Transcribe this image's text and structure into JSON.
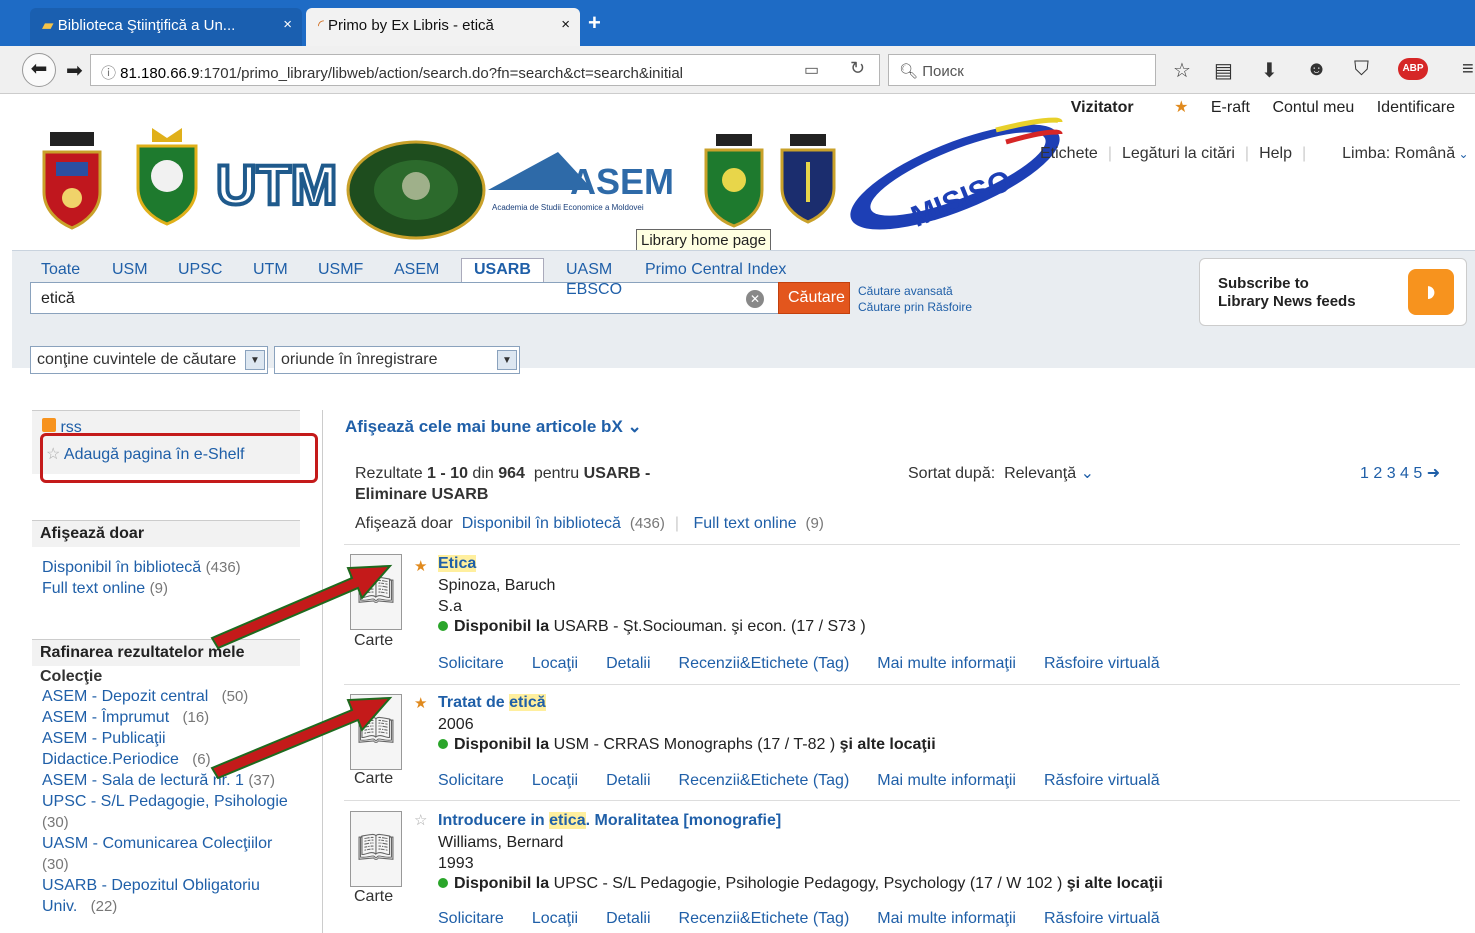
{
  "browser": {
    "tabs": [
      {
        "label": "Biblioteca Ştiinţifică a Un...",
        "close": "×"
      },
      {
        "label": "Primo by Ex Libris - etică",
        "close": "×"
      }
    ],
    "new_tab": "+",
    "url_host": "81.180.66.9",
    "url_rest": ":1701/primo_library/libweb/action/search.do?fn=search&ct=search&initial",
    "search_placeholder": "Поиск"
  },
  "header": {
    "user_links": [
      "Vizitator",
      "E-raft",
      "Contul meu",
      "Identificare"
    ],
    "secondary": {
      "tags": "Etichete",
      "citations": "Legături la citări",
      "help": "Help",
      "lang_label": "Limba:",
      "lang_value": "Română"
    },
    "logo_utm": "UTM",
    "logo_asem": "ASEM",
    "logo_asem_sub": "Academia de Studii Economice a Moldovei",
    "logo_misiso": "MISISO",
    "tooltip": "Library home page"
  },
  "scopes": [
    "Toate",
    "USM",
    "UPSC",
    "UTM",
    "USMF",
    "ASEM",
    "USARB",
    "UASM",
    "Primo Central Index"
  ],
  "scope_extra": "EBSCO",
  "search": {
    "value": "etică",
    "button": "Căutare",
    "advanced": "Căutare avansată",
    "browse": "Căutare prin Răsfoire"
  },
  "rss_feed": {
    "line1": "Subscribe to",
    "line2": "Library News feeds"
  },
  "filters": {
    "mode": "conţine cuvintele de căutare",
    "field": "oriunde în înregistrare"
  },
  "left": {
    "rss": "rss",
    "eshelf": "Adaugă pagina în e-Shelf",
    "show_only_title": "Afişează doar",
    "show_only": [
      {
        "label": "Disponibil în bibliotecă",
        "count": "(436)"
      },
      {
        "label": "Full text online",
        "count": "(9)"
      }
    ],
    "refine_title": "Rafinarea rezultatelor mele",
    "collection": "Colecţie",
    "facets": [
      {
        "label": "ASEM - Depozit central",
        "count": "(50)"
      },
      {
        "label": "ASEM - Împrumut",
        "count": "(16)"
      },
      {
        "label": "ASEM - Publicaţii Didactice.Periodice",
        "count": "(6)"
      },
      {
        "label": "ASEM - Sala de lectură nr. 1",
        "count": "(37)"
      },
      {
        "label": "UPSC - S/L Pedagogie, Psihologie",
        "count": "(30)"
      },
      {
        "label": "UASM - Comunicarea Colecţiilor",
        "count": "(30)"
      },
      {
        "label": "USARB - Depozitul Obligatoriu Univ.",
        "count": "(22)"
      }
    ]
  },
  "results_header": {
    "bx": "Afişează cele mai bune articole bX",
    "summary_prefix": "Rezultate",
    "range": "1 - 10",
    "of": "din",
    "total": "964",
    "for": "pentru",
    "scope": "USARB -",
    "remove": "Eliminare USARB",
    "sort_label": "Sortat după:",
    "sort_value": "Relevanţă",
    "pages": "1 2 3 4 5",
    "show_only": "Afişează doar",
    "avail": "Disponibil în bibliotecă",
    "avail_count": "(436)",
    "fulltext": "Full text online",
    "fulltext_count": "(9)"
  },
  "results": [
    {
      "title_pre": "",
      "title_hl": "Etica",
      "title_post": "",
      "author": "Spinoza, Baruch",
      "extra": "S.a",
      "avail_bold": "Disponibil la",
      "avail_text": "USARB - Şt.Sociouman. şi econ.  (17 / S73 )",
      "avail_more": "",
      "type": "Carte"
    },
    {
      "title_pre": "Tratat de ",
      "title_hl": "etică",
      "title_post": "",
      "author": "",
      "extra": "2006",
      "avail_bold": "Disponibil la",
      "avail_text": "USM - CRRAS Monographs (17 / T-82 )",
      "avail_more": "şi alte locaţii",
      "type": "Carte"
    },
    {
      "title_pre": "Introducere in ",
      "title_hl": "etica",
      "title_post": ". Moralitatea [monografie]",
      "author": "Williams, Bernard",
      "extra": "1993",
      "avail_bold": "Disponibil la",
      "avail_text": "UPSC - S/L Pedagogie, Psihologie Pedagogy, Psychology (17 / W 102 )",
      "avail_more": "şi alte locaţii",
      "type": "Carte"
    }
  ],
  "result_tabs": [
    "Solicitare",
    "Locaţii",
    "Detalii",
    "Recenzii&Etichete (Tag)",
    "Mai multe informaţii",
    "Răsfoire virtuală"
  ],
  "colors": {
    "accent": "#1f5fa8",
    "search_button": "#e3561d",
    "annotation": "#c41a1a",
    "browser": "#1e6bc5"
  }
}
